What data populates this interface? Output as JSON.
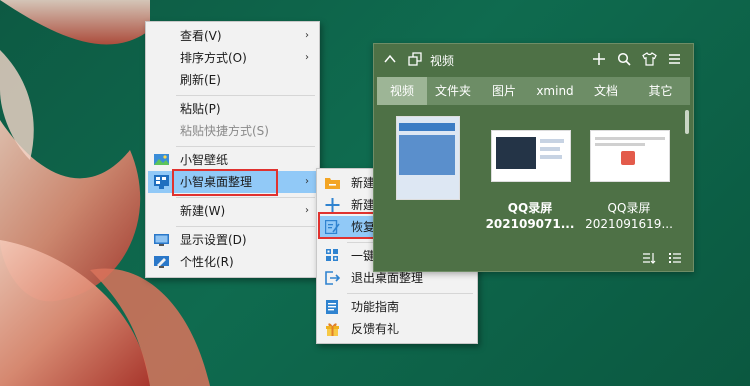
{
  "context_menu": {
    "items": [
      {
        "label": "查看(V)",
        "has_submenu": true
      },
      {
        "label": "排序方式(O)",
        "has_submenu": true
      },
      {
        "label": "刷新(E)"
      },
      {
        "label": "粘贴(P)"
      },
      {
        "label": "粘贴快捷方式(S)",
        "disabled": true
      },
      {
        "label": "小智壁纸",
        "icon": "wallpaper-icon"
      },
      {
        "label": "小智桌面整理",
        "icon": "desktop-organize-icon",
        "has_submenu": true,
        "highlighted": true
      },
      {
        "label": "新建(W)",
        "has_submenu": true
      },
      {
        "label": "显示设置(D)",
        "icon": "display-settings-icon"
      },
      {
        "label": "个性化(R)",
        "icon": "personalize-icon"
      }
    ]
  },
  "submenu": {
    "items": [
      {
        "label": "新建快捷文件夹",
        "icon": "folder-plus-icon"
      },
      {
        "label": "新建分区",
        "icon": "plus-icon"
      },
      {
        "label": "恢复待办",
        "icon": "todo-restore-icon",
        "highlighted": true
      },
      {
        "label": "一键桌面整理",
        "icon": "grid-icon"
      },
      {
        "label": "退出桌面整理",
        "icon": "exit-icon"
      },
      {
        "label": "功能指南",
        "icon": "guide-icon"
      },
      {
        "label": "反馈有礼",
        "icon": "gift-icon"
      }
    ]
  },
  "widget": {
    "title": "视频",
    "tabs": [
      "视频",
      "文件夹",
      "图片",
      "xmind",
      "文档",
      "其它"
    ],
    "active_tab": "视频",
    "files": [
      {
        "name_line1": "",
        "name_line2": ""
      },
      {
        "name_line1": "QQ录屏",
        "name_line2": "202109071..."
      },
      {
        "name_line1": "QQ录屏",
        "name_line2": "2021091619..."
      }
    ]
  },
  "colors": {
    "menu_highlight": "#91c9f7",
    "annotation_red": "#e0322f",
    "widget_bg": "#4e7146",
    "tab_active": "#9db596"
  }
}
